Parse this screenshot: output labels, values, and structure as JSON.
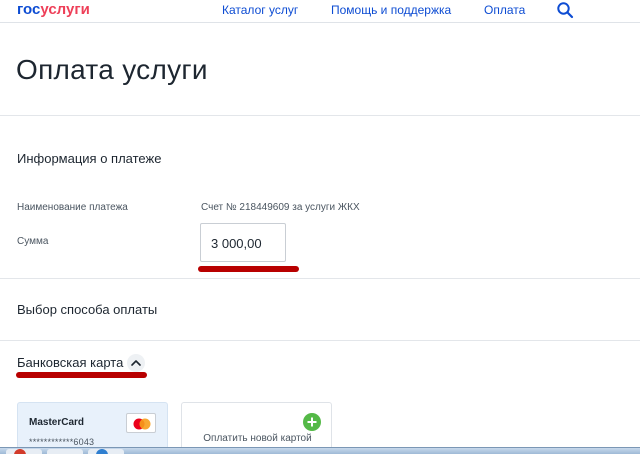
{
  "header": {
    "logo_part1": "гос",
    "logo_part2": "услуги",
    "nav": [
      "Каталог услуг",
      "Помощь и поддержка",
      "Оплата"
    ]
  },
  "page_title": "Оплата услуги",
  "payment_info": {
    "title": "Информация о платеже",
    "name_label": "Наименование платежа",
    "name_value": "Счет № 218449609 за услуги ЖКХ",
    "amount_label": "Сумма",
    "amount_value": "3 000,00"
  },
  "payment_method": {
    "title": "Выбор способа оплаты",
    "bank_card_label": "Банковская карта",
    "saved_card": {
      "name": "MasterCard",
      "number": "************6043"
    },
    "new_card_label": "Оплатить новой картой"
  },
  "colors": {
    "brand_blue": "#0d4cd3",
    "brand_red": "#ee3f58",
    "annotation_red": "#b80000",
    "add_green": "#54b947"
  }
}
